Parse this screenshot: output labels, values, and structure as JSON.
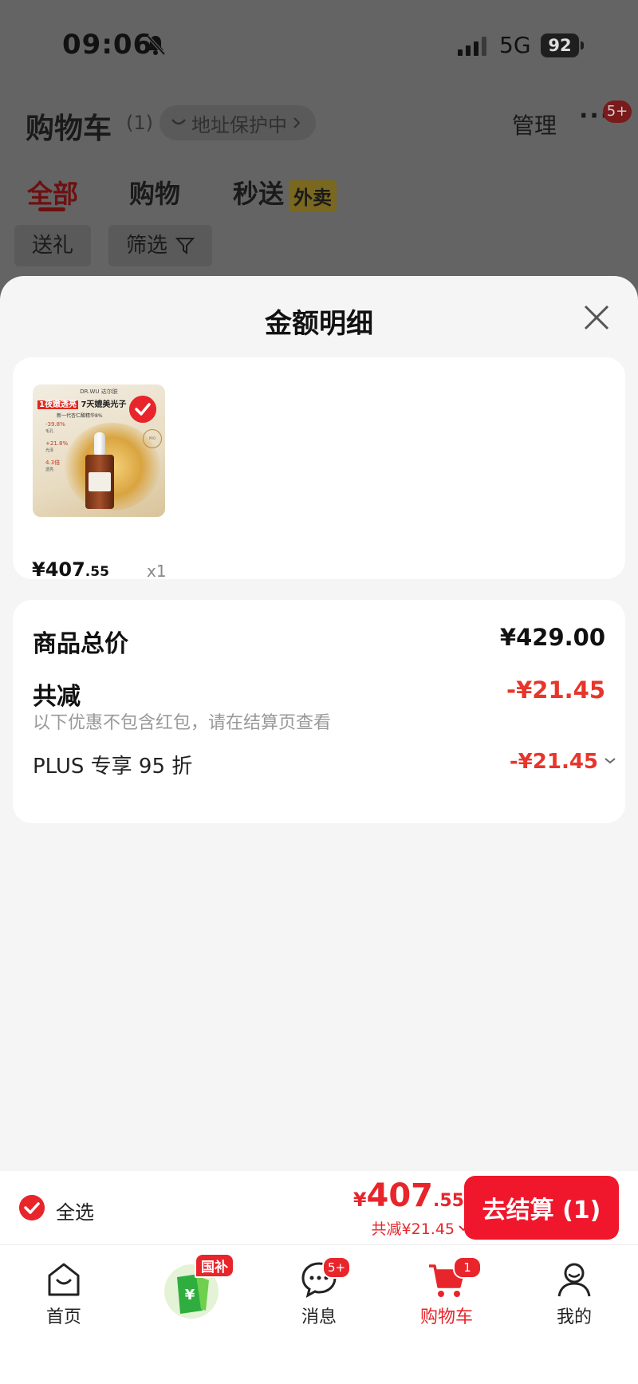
{
  "status_bar": {
    "time": "09:06",
    "network": "5G",
    "battery": "92"
  },
  "header": {
    "title": "购物车",
    "count": "(1)",
    "address_protect": "地址保护中",
    "manage": "管理",
    "more_badge": "5+"
  },
  "tabs": [
    {
      "label": "全部"
    },
    {
      "label": "购物"
    },
    {
      "label": "秒送",
      "badge": "外卖"
    }
  ],
  "filters": [
    {
      "label": "送礼"
    },
    {
      "label": "筛选"
    }
  ],
  "sheet": {
    "title": "金额明细",
    "product": {
      "price_int": "¥407",
      "price_dec": ".55",
      "qty": "x1",
      "thumb": {
        "brand": "DR.WU 达尔肤",
        "headline_red": "1夜嫩透亮",
        "headline_dark": "7天媲美光子",
        "sub": "新一代杏仁酸精华8%",
        "stat1": "-39.8%",
        "stat1_sub": "毛孔",
        "stat2": "+21.8%",
        "stat2_sub": "光泽",
        "stat3": "4.3倍",
        "stat3_sub": "透亮",
        "seal": "PRO"
      }
    },
    "summary": {
      "total_label": "商品总价",
      "total_value": "¥429.00",
      "discount_label": "共减",
      "discount_value": "-¥21.45",
      "note": "以下优惠不包含红包，请在结算页查看",
      "plus_label": "PLUS 专享 95 折",
      "plus_value": "-¥21.45"
    }
  },
  "checkout": {
    "select_all": "全选",
    "currency": "¥",
    "total_int": "407",
    "total_dec": ".55",
    "discount": "共减¥21.45",
    "button": "去结算 (1)"
  },
  "tab_bar": {
    "items": [
      {
        "label": "首页",
        "icon": "home-icon"
      },
      {
        "label": "",
        "icon": "guobu-bag-icon",
        "badge": "国补"
      },
      {
        "label": "消息",
        "icon": "message-icon",
        "badge": "5+"
      },
      {
        "label": "购物车",
        "icon": "cart-icon",
        "badge": "1"
      },
      {
        "label": "我的",
        "icon": "profile-icon"
      }
    ]
  },
  "colors": {
    "accent_red": "#e8252b",
    "sheet_bg": "#f5f5f5",
    "overlay_bg": "#646464"
  }
}
